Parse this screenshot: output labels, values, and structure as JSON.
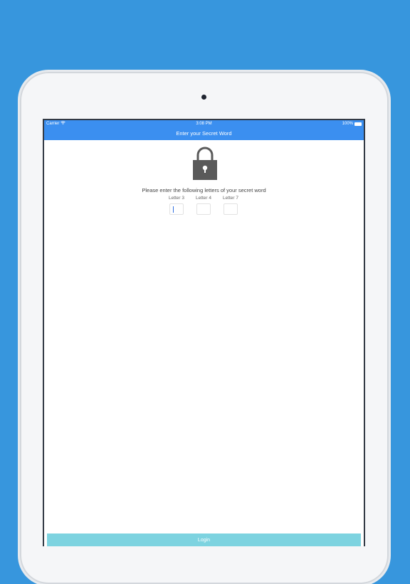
{
  "status_bar": {
    "carrier": "Carrier",
    "time": "3:08 PM",
    "battery": "100%",
    "wifi_icon": "wifi-icon",
    "battery_icon": "battery-icon"
  },
  "nav": {
    "title": "Enter your Secret Word"
  },
  "lock_icon": "lock-icon",
  "prompt": "Please enter the following letters of your secret word",
  "letters": [
    {
      "label": "Letter 3",
      "value": ""
    },
    {
      "label": "Letter 4",
      "value": ""
    },
    {
      "label": "Letter 7",
      "value": ""
    }
  ],
  "login_button": {
    "label": "Login"
  },
  "colors": {
    "background": "#3796dd",
    "nav": "#3b8ff0",
    "button": "#7dd3e0",
    "lock": "#5a5a5a"
  }
}
